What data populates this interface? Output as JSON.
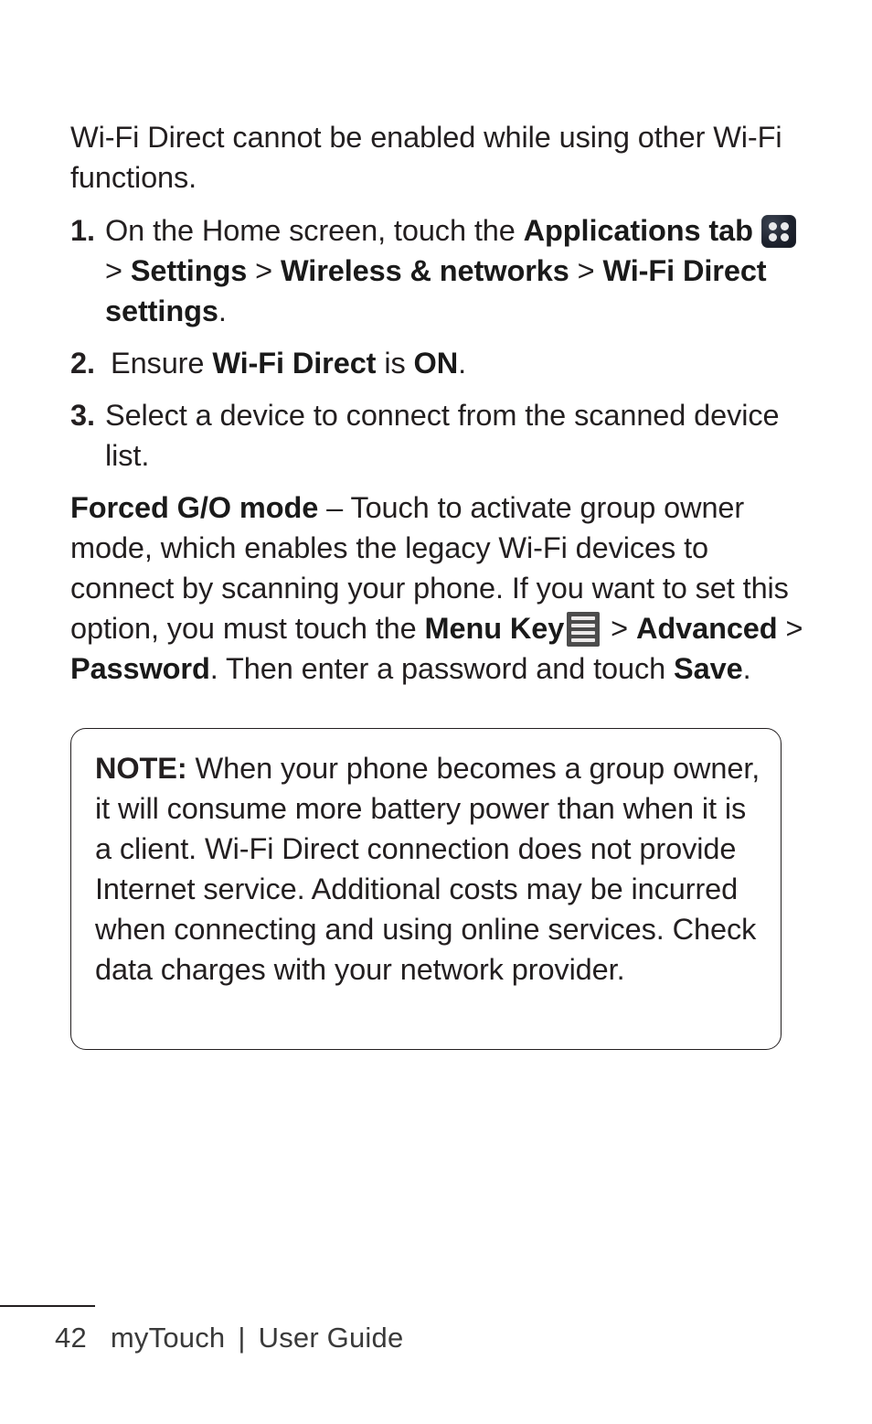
{
  "page": {
    "background": "#ffffff",
    "text_color": "#231f20"
  },
  "intro": {
    "text": "Wi-Fi Direct cannot be enabled while using other Wi-Fi functions."
  },
  "steps": [
    {
      "number": "1.",
      "part1": "On the Home screen, touch the ",
      "bold1": "Applications tab",
      "icon": "apps-grid-icon",
      "sep1": " > ",
      "bold2": "Settings",
      "sep2": " > ",
      "bold3": "Wireless & networks",
      "sep3": " > ",
      "bold4": "Wi-Fi Direct settings",
      "end": "."
    },
    {
      "number": "2.",
      "part1": " Ensure ",
      "bold1": "Wi-Fi Direct",
      "part2": " is ",
      "bold2": "ON",
      "end": "."
    },
    {
      "number": "3.",
      "part1": "Select a device to connect from the scanned device list."
    }
  ],
  "forced_go": {
    "label": "Forced G/O mode",
    "dash": " – ",
    "body1": "Touch to activate group owner mode, which enables the legacy Wi-Fi devices to connect by scanning your phone. If you want to set this option, you must touch the ",
    "menu_key": "Menu Key",
    "icon": "menu-key-icon",
    "sep1": " > ",
    "advanced": "Advanced",
    "sep2": " > ",
    "password": "Password",
    "body2": ". Then enter a password and touch ",
    "save": "Save",
    "end": "."
  },
  "note": {
    "label": "NOTE:",
    "body": " When your phone becomes a group owner, it will consume more battery power than when it is a client. Wi-Fi Direct connection does not provide Internet service. Additional costs may be incurred when connecting and using online services. Check data charges with your network provider."
  },
  "footer": {
    "page_number": "42",
    "product": "myTouch",
    "separator": "|",
    "doc_title": "User Guide"
  }
}
